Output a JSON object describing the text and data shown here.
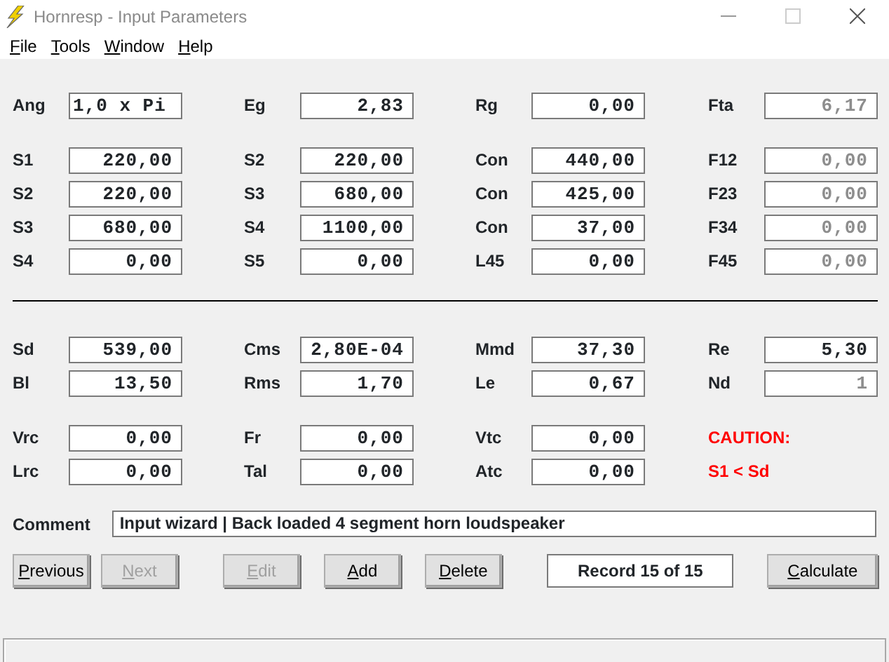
{
  "window": {
    "title": "Hornresp - Input Parameters"
  },
  "menu": [
    {
      "label": "File"
    },
    {
      "label": "Tools"
    },
    {
      "label": "Window"
    },
    {
      "label": "Help"
    }
  ],
  "groups": [
    {
      "kind": "fields",
      "rows": [
        [
          {
            "label": "Ang",
            "value": "1,0 x Pi",
            "disabled": false
          },
          {
            "label": "Eg",
            "value": "2,83",
            "disabled": false
          },
          {
            "label": "Rg",
            "value": "0,00",
            "disabled": false
          },
          {
            "label": "Fta",
            "value": "6,17",
            "disabled": true
          }
        ]
      ]
    },
    {
      "kind": "fields",
      "rows": [
        [
          {
            "label": "S1",
            "value": "220,00",
            "disabled": false
          },
          {
            "label": "S2",
            "value": "220,00",
            "disabled": false
          },
          {
            "label": "Con",
            "value": "440,00",
            "disabled": false
          },
          {
            "label": "F12",
            "value": "0,00",
            "disabled": true
          }
        ],
        [
          {
            "label": "S2",
            "value": "220,00",
            "disabled": false
          },
          {
            "label": "S3",
            "value": "680,00",
            "disabled": false
          },
          {
            "label": "Con",
            "value": "425,00",
            "disabled": false
          },
          {
            "label": "F23",
            "value": "0,00",
            "disabled": true
          }
        ],
        [
          {
            "label": "S3",
            "value": "680,00",
            "disabled": false
          },
          {
            "label": "S4",
            "value": "1100,00",
            "disabled": false
          },
          {
            "label": "Con",
            "value": "37,00",
            "disabled": false
          },
          {
            "label": "F34",
            "value": "0,00",
            "disabled": true
          }
        ],
        [
          {
            "label": "S4",
            "value": "0,00",
            "disabled": false
          },
          {
            "label": "S5",
            "value": "0,00",
            "disabled": false
          },
          {
            "label": "L45",
            "value": "0,00",
            "disabled": false
          },
          {
            "label": "F45",
            "value": "0,00",
            "disabled": true
          }
        ]
      ]
    },
    {
      "kind": "divider"
    },
    {
      "kind": "fields",
      "rows": [
        [
          {
            "label": "Sd",
            "value": "539,00",
            "disabled": false
          },
          {
            "label": "Cms",
            "value": "2,80E-04",
            "disabled": false
          },
          {
            "label": "Mmd",
            "value": "37,30",
            "disabled": false
          },
          {
            "label": "Re",
            "value": "5,30",
            "disabled": false
          }
        ],
        [
          {
            "label": "Bl",
            "value": "13,50",
            "disabled": false
          },
          {
            "label": "Rms",
            "value": "1,70",
            "disabled": false
          },
          {
            "label": "Le",
            "value": "0,67",
            "disabled": false
          },
          {
            "label": "Nd",
            "value": "1",
            "disabled": true
          }
        ]
      ]
    },
    {
      "kind": "fields",
      "rows": [
        [
          {
            "label": "Vrc",
            "value": "0,00",
            "disabled": false
          },
          {
            "label": "Fr",
            "value": "0,00",
            "disabled": false
          },
          {
            "label": "Vtc",
            "value": "0,00",
            "disabled": false
          },
          {
            "kind": "caution",
            "text": "CAUTION:"
          }
        ],
        [
          {
            "label": "Lrc",
            "value": "0,00",
            "disabled": false
          },
          {
            "label": "Tal",
            "value": "0,00",
            "disabled": false
          },
          {
            "label": "Atc",
            "value": "0,00",
            "disabled": false
          },
          {
            "kind": "caution",
            "text": "S1 < Sd"
          }
        ]
      ]
    }
  ],
  "comment": {
    "label": "Comment",
    "value": "Input wizard | Back loaded 4 segment horn loudspeaker"
  },
  "buttons": [
    {
      "label": "Previous",
      "disabled": false
    },
    {
      "label": "Next",
      "disabled": true
    },
    {
      "label": "Edit",
      "disabled": true
    },
    {
      "label": "Add",
      "disabled": false
    },
    {
      "label": "Delete",
      "disabled": false
    }
  ],
  "record": "Record 15 of 15",
  "calculate": {
    "label": "Calculate",
    "disabled": false
  }
}
